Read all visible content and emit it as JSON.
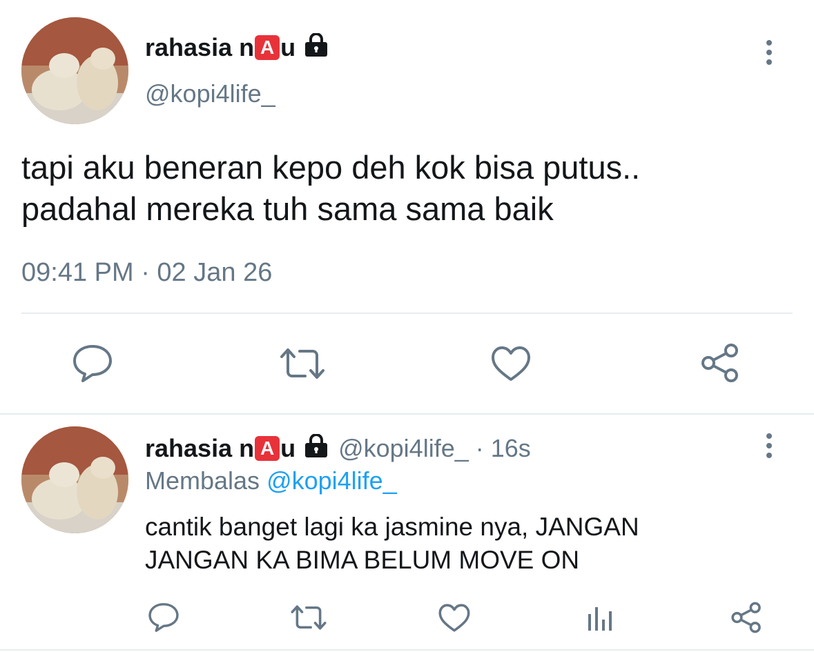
{
  "main_tweet": {
    "author_name_prefix": "rahasia n",
    "author_badge": "A",
    "author_name_suffix": "u",
    "lock_icon": "lock-icon",
    "handle": "@kopi4life_",
    "text_line1": "tapi aku beneran kepo deh kok bisa putus..",
    "text_line2": "padahal mereka tuh sama sama baik",
    "timestamp": "09:41 PM · 02 Jan 26",
    "actions": [
      "reply-icon",
      "retweet-icon",
      "like-icon",
      "share-icon"
    ]
  },
  "reply_tweet": {
    "author_name_prefix": "rahasia n",
    "author_badge": "A",
    "author_name_suffix": "u",
    "handle": "@kopi4life_",
    "time": "· 16s",
    "replying_label": "Membalas",
    "replying_to": "@kopi4life_",
    "text_line1": "cantik banget lagi ka jasmine nya, JANGAN",
    "text_line2": "JANGAN KA BIMA BELUM MOVE ON",
    "actions": [
      "reply-icon",
      "retweet-icon",
      "like-icon",
      "analytics-icon",
      "share-icon"
    ]
  },
  "colors": {
    "text": "#14171a",
    "secondary": "#657786",
    "link": "#1da1f2",
    "badge": "#e8323a",
    "divider": "#e6ecf0"
  }
}
